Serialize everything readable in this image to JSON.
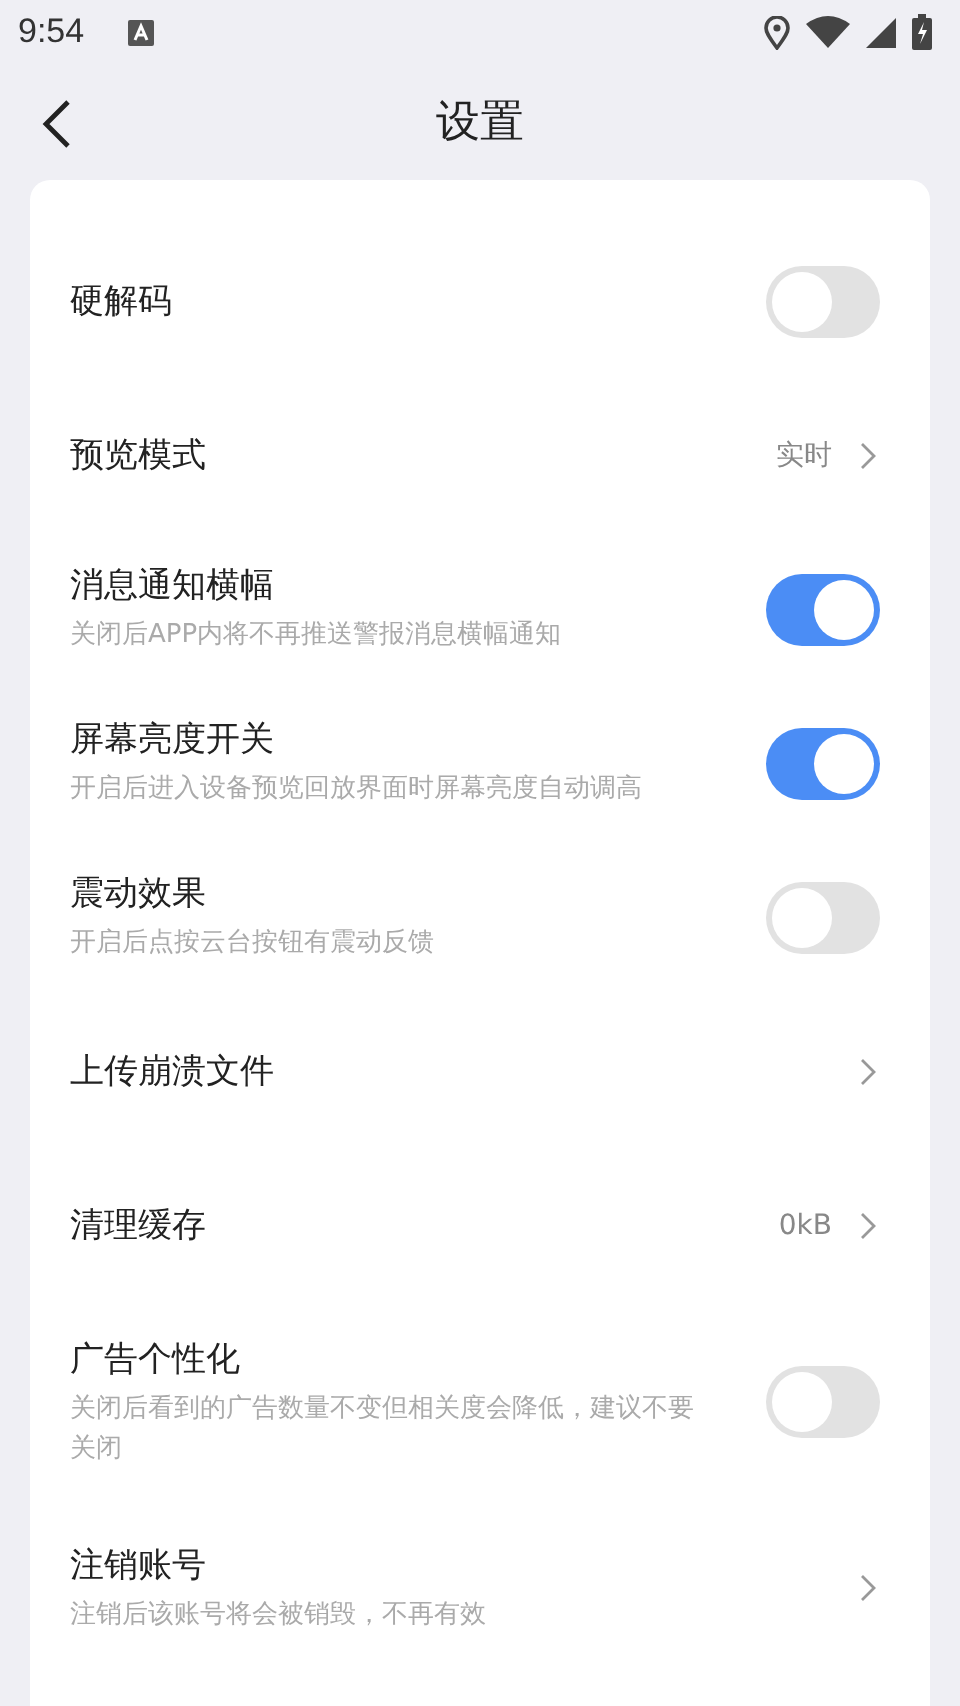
{
  "status_bar": {
    "time": "9:54"
  },
  "header": {
    "title": "设置"
  },
  "settings": [
    {
      "kind": "toggle",
      "label": "硬解码",
      "on": false
    },
    {
      "kind": "link",
      "label": "预览模式",
      "value": "实时"
    },
    {
      "kind": "toggle",
      "label": "消息通知横幅",
      "description": "关闭后APP内将不再推送警报消息横幅通知",
      "on": true
    },
    {
      "kind": "toggle",
      "label": "屏幕亮度开关",
      "description": "开启后进入设备预览回放界面时屏幕亮度自动调高",
      "on": true
    },
    {
      "kind": "toggle",
      "label": "震动效果",
      "description": "开启后点按云台按钮有震动反馈",
      "on": false
    },
    {
      "kind": "link",
      "label": "上传崩溃文件"
    },
    {
      "kind": "link",
      "label": "清理缓存",
      "value": "0kB"
    },
    {
      "kind": "toggle",
      "label": "广告个性化",
      "description": "关闭后看到的广告数量不变但相关度会降低，建议不要关闭",
      "on": false
    },
    {
      "kind": "link",
      "label": "注销账号",
      "description": "注销后该账号将会被销毁，不再有效"
    }
  ]
}
